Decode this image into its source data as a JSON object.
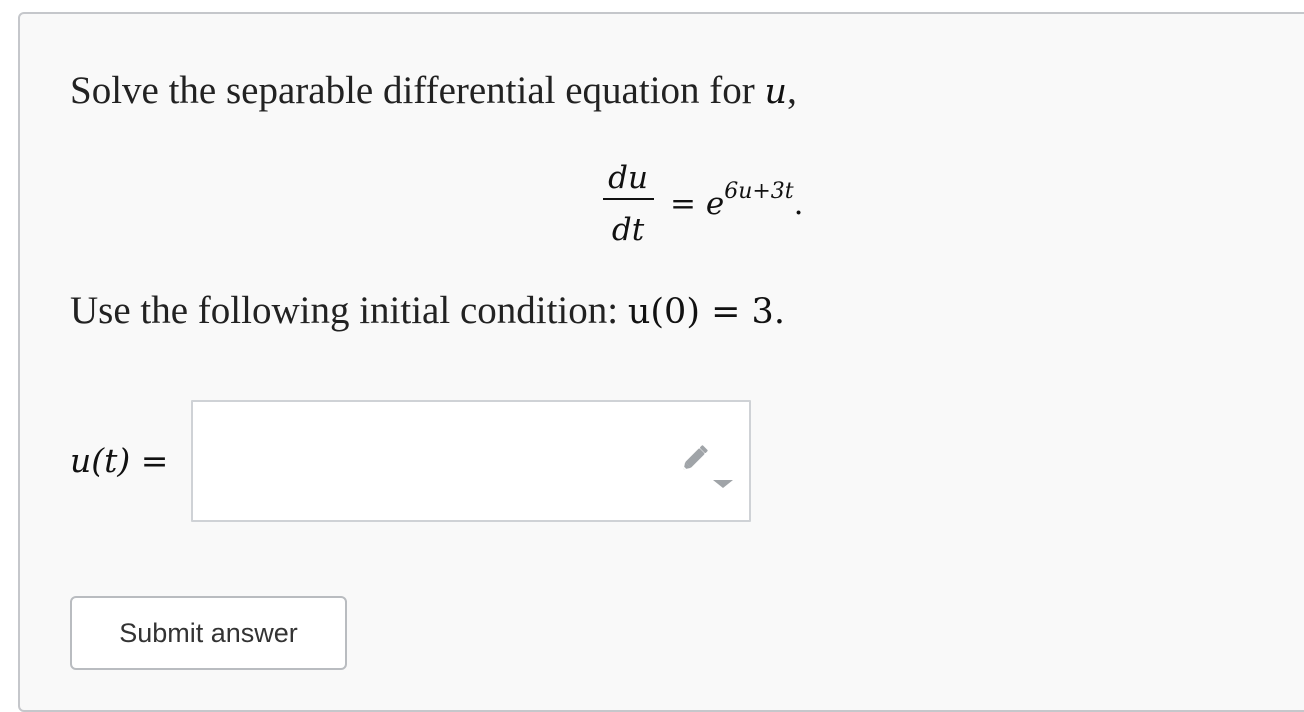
{
  "question": {
    "prompt_text": "Solve the separable differential equation for ",
    "prompt_var": "u",
    "prompt_end": ",",
    "equation": {
      "numerator": "du",
      "denominator": "dt",
      "equals": "=",
      "base": "e",
      "exponent": "6u+3t",
      "end": "."
    },
    "condition_text": "Use the following initial condition: ",
    "condition_math": "u(0) = 3."
  },
  "answer": {
    "label": "u(t) =",
    "value": ""
  },
  "actions": {
    "submit_label": "Submit answer"
  },
  "colors": {
    "card_background": "#f9f9f9",
    "card_border": "#c5c7cb",
    "input_border": "#cfd2d6",
    "icon_gray": "#a0a4a8"
  },
  "icons": {
    "input_edit": "pencil-icon",
    "input_dropdown": "caret-down-icon"
  }
}
